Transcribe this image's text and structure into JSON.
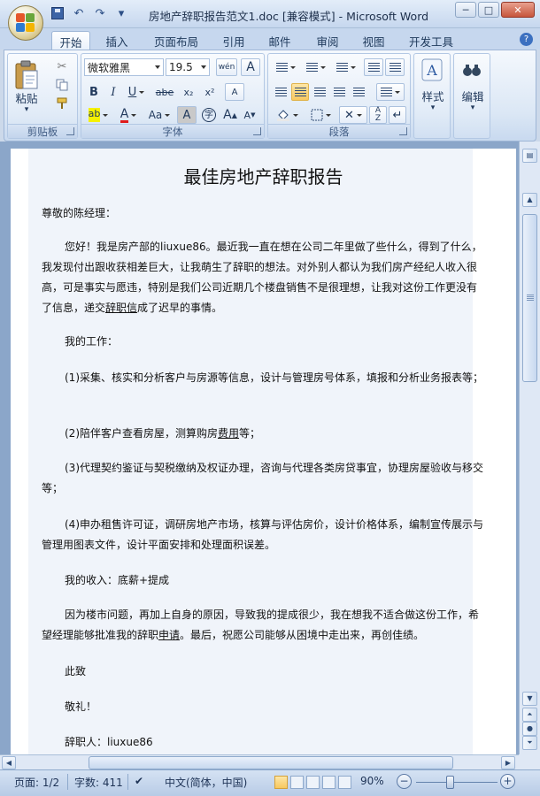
{
  "window": {
    "title": "房地产辞职报告范文1.doc [兼容模式] - Microsoft Word",
    "minimize": "─",
    "maximize": "□",
    "close": "✕"
  },
  "quick_access": {
    "undo": "↶",
    "redo": "↷",
    "more": "▾"
  },
  "tabs": [
    "开始",
    "插入",
    "页面布局",
    "引用",
    "邮件",
    "审阅",
    "视图",
    "开发工具"
  ],
  "ribbon": {
    "clipboard": {
      "label": "剪贴板",
      "paste": "粘贴"
    },
    "font": {
      "label": "字体",
      "font_name": "微软雅黑",
      "font_size": "19.5",
      "wen": "wén",
      "A_box": "A",
      "bold": "B",
      "italic": "I",
      "underline": "U",
      "strike": "abe",
      "subscript": "x₂",
      "superscript": "x²",
      "highlight": "ab",
      "font_color": "A",
      "change_case": "Aa",
      "char_shading": "A",
      "enclose": "字",
      "grow": "A",
      "shrink": "A",
      "clear_format": "A"
    },
    "paragraph": {
      "label": "段落"
    },
    "styles": {
      "label": "样式"
    },
    "editing": {
      "label": "编辑"
    }
  },
  "document": {
    "title": "最佳房地产辞职报告",
    "salutation": "尊敬的陈经理：",
    "para1_a": "您好！我是房产部的liuxue86。最近我一直在想在公司二年里做了些什么，得到了什么，我发现付出跟收获相差巨大，让我萌生了辞职的想法。对外别人都认为我们房产经纪人收入很高，可是事实与愿违，特别是我们公司近期几个楼盘销售不是很理想，让我对这份工作更没有了信息，递交",
    "para1_link": "辞职信",
    "para1_b": "成了迟早的事情。",
    "work_heading": "我的工作：",
    "item1": "(1)采集、核实和分析客户与房源等信息，设计与管理房号体系，填报和分析业务报表等；",
    "item2_a": "(2)陪伴客户查看房屋，测算购房",
    "item2_link": "费用",
    "item2_b": "等；",
    "item3": "(3)代理契约鉴证与契税缴纳及权证办理，咨询与代理各类房贷事宜，协理房屋验收与移交等；",
    "item4": "(4)申办租售许可证，调研房地产市场，核算与评估房价，设计价格体系，编制宣传展示与管理用图表文件，设计平面安排和处理面积误差。",
    "income": "我的收入：底薪+提成",
    "para2_a": "因为楼市问题，再加上自身的原因，导致我的提成很少，我在想我不适合做这份工作，希望经理能够批准我的辞职",
    "para2_link": "申请",
    "para2_b": "。最后，祝愿公司能够从困境中走出来，再创佳绩。",
    "closing1": "此致",
    "closing2": "敬礼！",
    "signature": "辞职人：liuxue86"
  },
  "statusbar": {
    "page": "页面: 1/2",
    "words": "字数: 411",
    "language": "中文(简体，中国)",
    "zoom": "90%",
    "zoom_minus": "−",
    "zoom_plus": "+"
  }
}
